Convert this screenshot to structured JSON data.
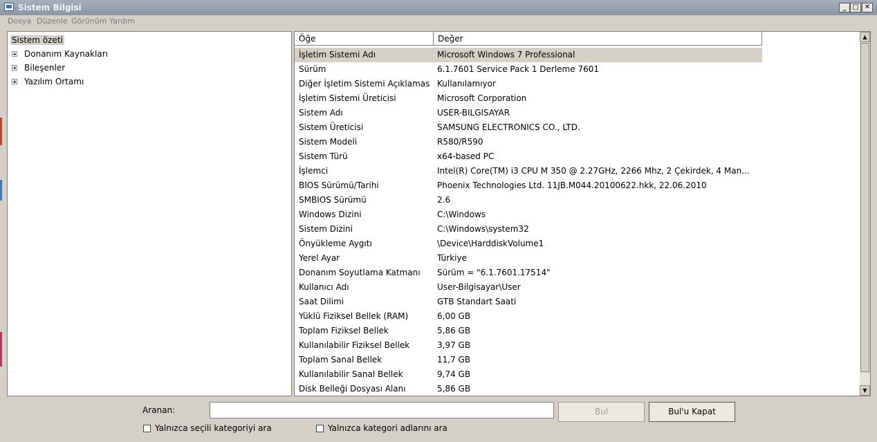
{
  "window": {
    "title": "Sistem Bilgisi",
    "minimize": "_",
    "maximize": "□",
    "close": "✕"
  },
  "menu": [
    "Dosya",
    "Düzenle",
    "Görünüm",
    "Yardım"
  ],
  "tree": {
    "root": "Sistem özeti",
    "items": [
      "Donanım Kaynakları",
      "Bileşenler",
      "Yazılım Ortamı"
    ]
  },
  "table": {
    "columns": [
      "Öğe",
      "Değer"
    ],
    "rows": [
      [
        "İşletim Sistemi Adı",
        "Microsoft Windows 7 Professional"
      ],
      [
        "Sürüm",
        "6.1.7601 Service Pack 1 Derleme 7601"
      ],
      [
        "Diğer İşletim Sistemi Açıklaması",
        "Kullanılamıyor"
      ],
      [
        "İşletim Sistemi Üreticisi",
        "Microsoft Corporation"
      ],
      [
        "Sistem Adı",
        "USER-BILGISAYAR"
      ],
      [
        "Sistem Üreticisi",
        "SAMSUNG ELECTRONICS CO., LTD."
      ],
      [
        "Sistem Modeli",
        "R580/R590"
      ],
      [
        "Sistem Türü",
        "x64-based PC"
      ],
      [
        "İşlemci",
        "Intel(R) Core(TM) i3 CPU       M 350  @ 2.27GHz, 2266 Mhz, 2 Çekirdek, 4 Man..."
      ],
      [
        "BIOS Sürümü/Tarihi",
        "Phoenix Technologies Ltd. 11JB.M044.20100622.hkk, 22.06.2010"
      ],
      [
        "SMBIOS Sürümü",
        "2.6"
      ],
      [
        "Windows Dizini",
        "C:\\Windows"
      ],
      [
        "Sistem Dizini",
        "C:\\Windows\\system32"
      ],
      [
        "Önyükleme Aygıtı",
        "\\Device\\HarddiskVolume1"
      ],
      [
        "Yerel Ayar",
        "Türkiye"
      ],
      [
        "Donanım Soyutlama Katmanı",
        "Sürüm = \"6.1.7601.17514\""
      ],
      [
        "Kullanıcı Adı",
        "User-Bilgisayar\\User"
      ],
      [
        "Saat Dilimi",
        "GTB Standart Saati"
      ],
      [
        "Yüklü Fiziksel Bellek (RAM)",
        "6,00 GB"
      ],
      [
        "Toplam Fiziksel Bellek",
        "5,86 GB"
      ],
      [
        "Kullanılabilir Fiziksel Bellek",
        "3,97 GB"
      ],
      [
        "Toplam Sanal Bellek",
        "11,7 GB"
      ],
      [
        "Kullanılabilir Sanal Bellek",
        "9,74 GB"
      ],
      [
        "Disk Belleği Dosyası Alanı",
        "5,86 GB"
      ]
    ]
  },
  "search": {
    "label": "Aranan:",
    "value": "",
    "find_button": "Bul",
    "close_find_button": "Bul'u Kapat",
    "option_selected_category": "Yalnızca seçili kategoriyi ara",
    "option_category_names": "Yalnızca kategori adlarını ara"
  }
}
